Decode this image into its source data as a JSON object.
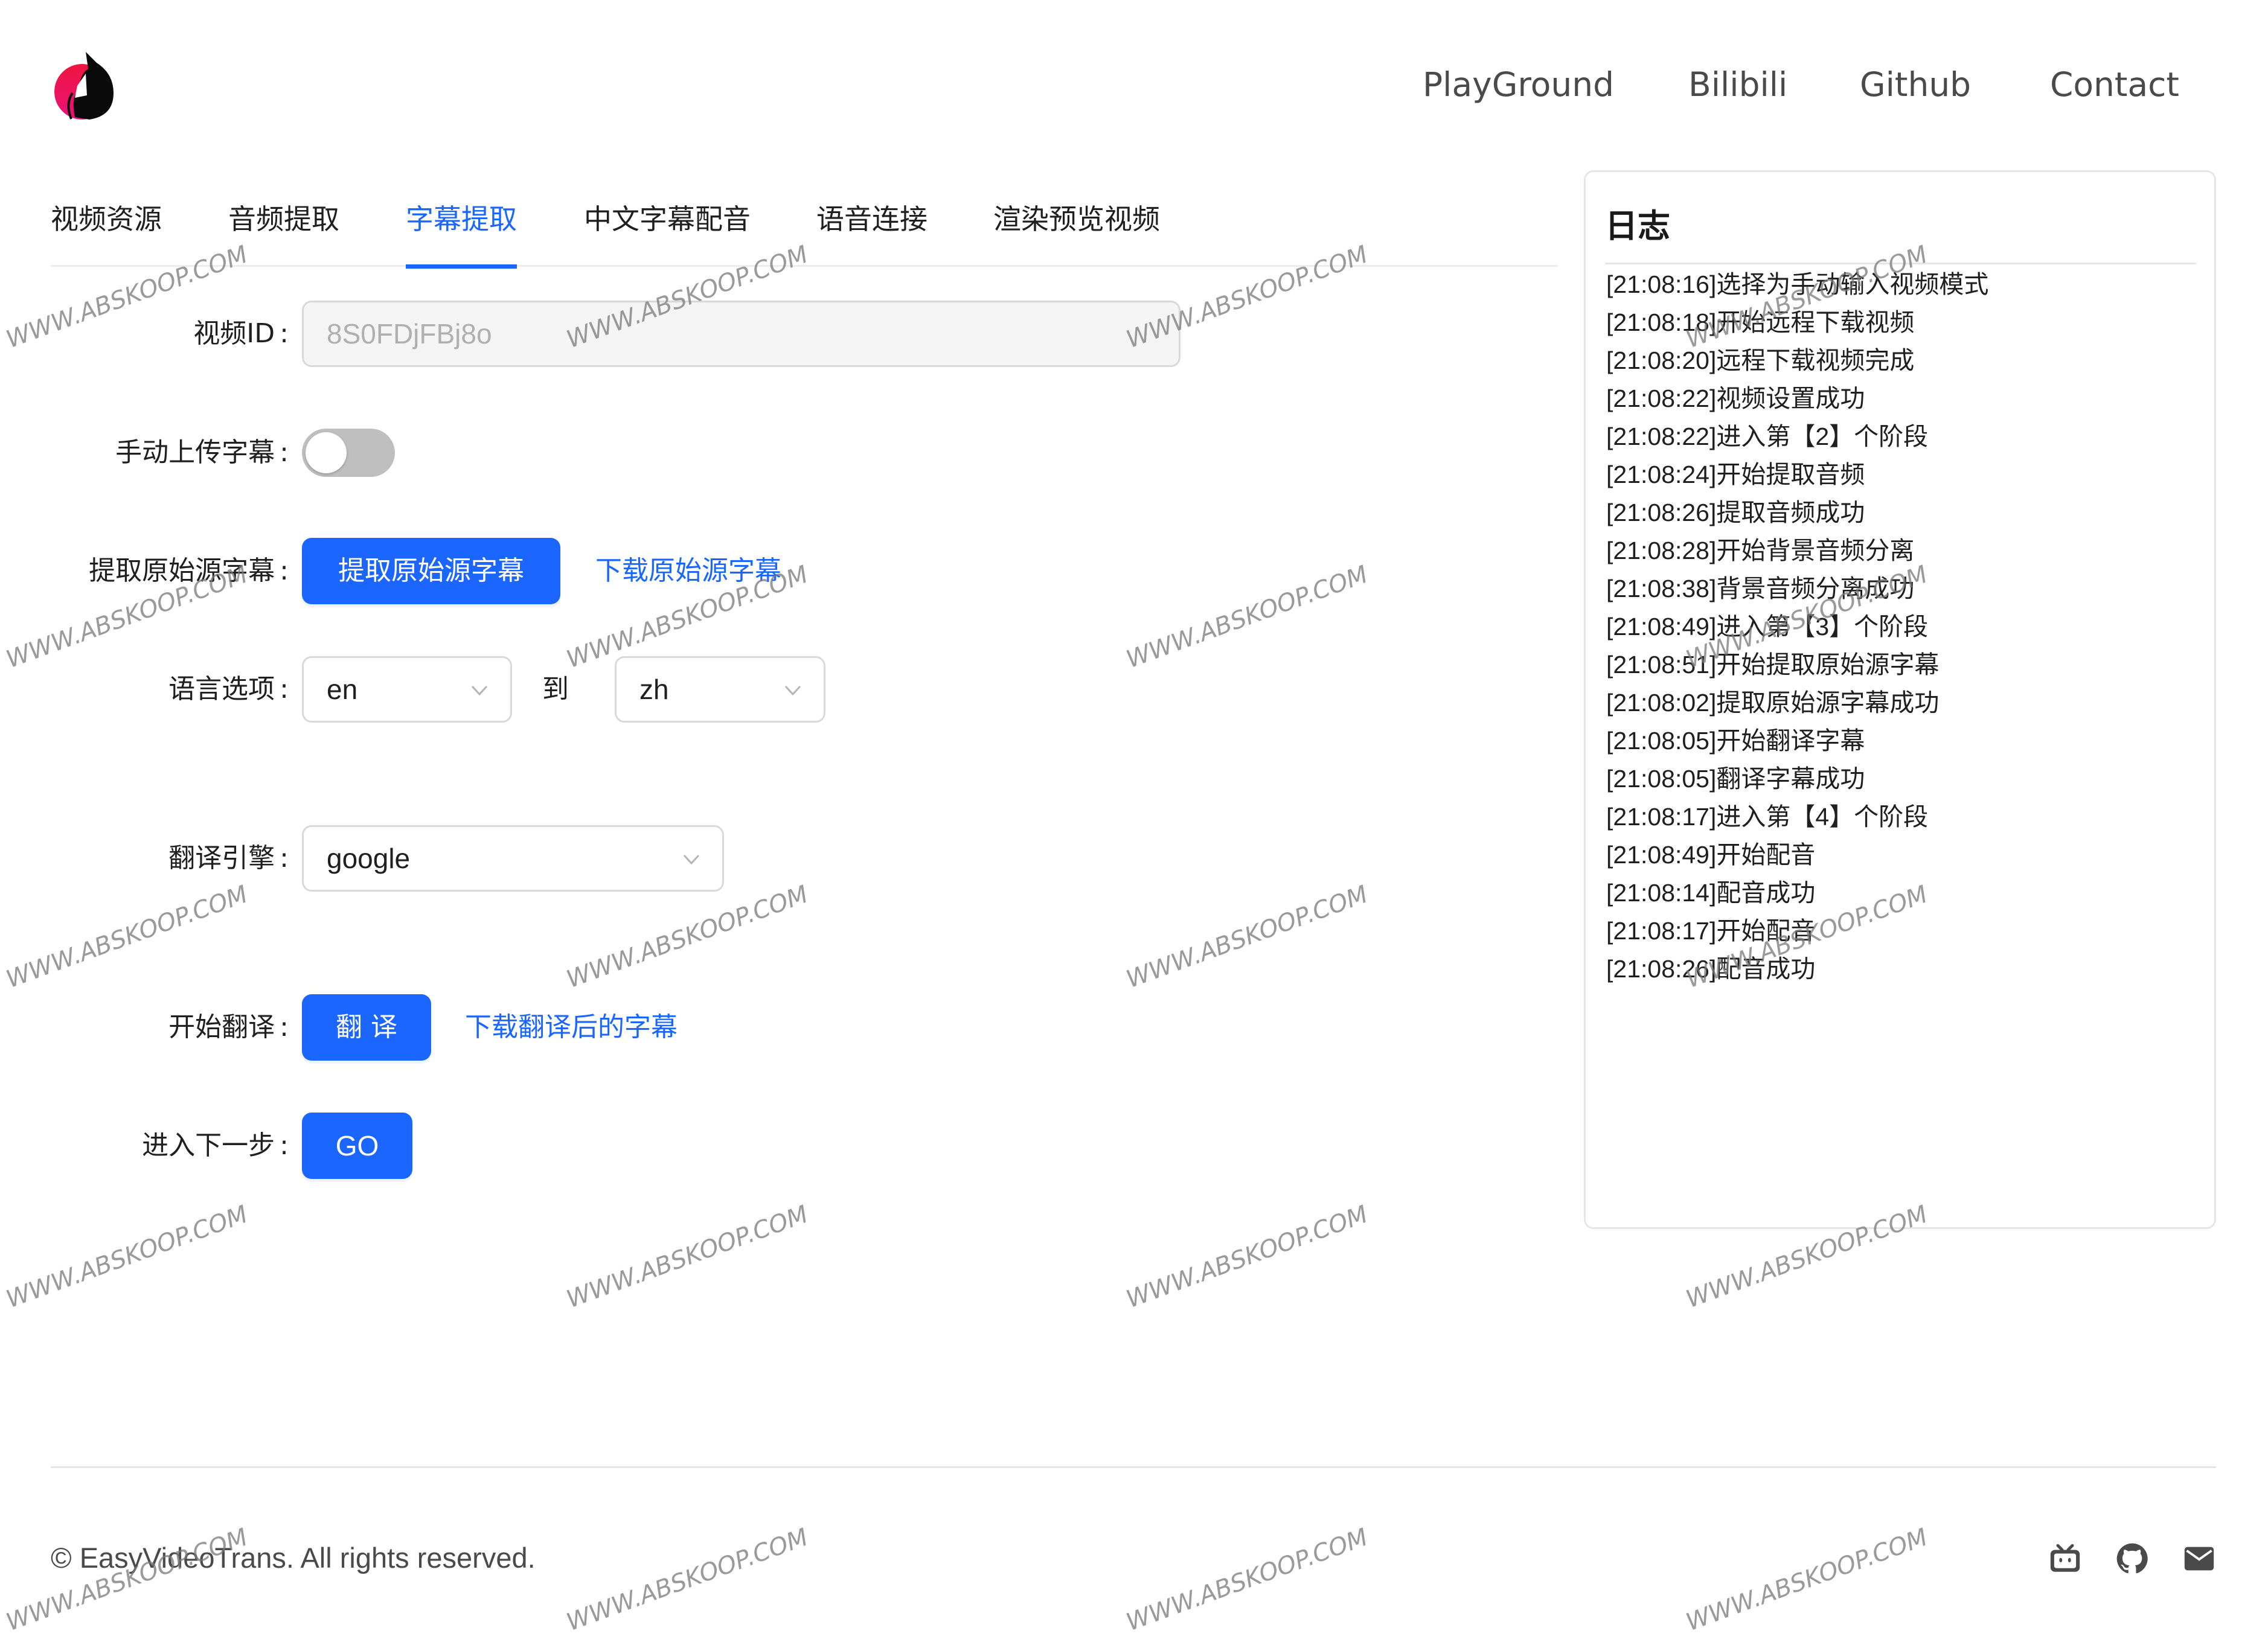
{
  "header": {
    "logo_alt": "cat-logo",
    "nav": [
      {
        "label": "PlayGround"
      },
      {
        "label": "Bilibili"
      },
      {
        "label": "Github"
      },
      {
        "label": "Contact"
      }
    ]
  },
  "tabs": [
    {
      "label": "视频资源",
      "active": false
    },
    {
      "label": "音频提取",
      "active": false
    },
    {
      "label": "字幕提取",
      "active": true
    },
    {
      "label": "中文字幕配音",
      "active": false
    },
    {
      "label": "语音连接",
      "active": false
    },
    {
      "label": "渲染预览视频",
      "active": false
    }
  ],
  "form": {
    "colon": ":",
    "video_id": {
      "label": "视频ID",
      "value": "8S0FDjFBj8o",
      "disabled": true
    },
    "manual_upload": {
      "label": "手动上传字幕",
      "checked": false
    },
    "extract": {
      "label": "提取原始源字幕",
      "button": "提取原始源字幕",
      "download_link": "下载原始源字幕"
    },
    "language": {
      "label": "语言选项",
      "source": "en",
      "to_label": "到",
      "target": "zh"
    },
    "engine": {
      "label": "翻译引擎",
      "value": "google"
    },
    "translate": {
      "label": "开始翻译",
      "button": "翻 译",
      "download_link": "下载翻译后的字幕"
    },
    "next_step": {
      "label": "进入下一步",
      "button": "GO"
    }
  },
  "log": {
    "title": "日志",
    "entries": [
      "[21:08:16]选择为手动输入视频模式",
      "[21:08:18]开始远程下载视频",
      "[21:08:20]远程下载视频完成",
      "[21:08:22]视频设置成功",
      "[21:08:22]进入第【2】个阶段",
      "[21:08:24]开始提取音频",
      "[21:08:26]提取音频成功",
      "[21:08:28]开始背景音频分离",
      "[21:08:38]背景音频分离成功",
      "[21:08:49]进入第【3】个阶段",
      "[21:08:51]开始提取原始源字幕",
      "[21:08:02]提取原始源字幕成功",
      "[21:08:05]开始翻译字幕",
      "[21:08:05]翻译字幕成功",
      "[21:08:17]进入第【4】个阶段",
      "[21:08:49]开始配音",
      "[21:08:14]配音成功",
      "[21:08:17]开始配音",
      "[21:08:26]配音成功"
    ]
  },
  "footer": {
    "copyright": "© EasyVideoTrans. All rights reserved.",
    "icons": [
      "bilibili-icon",
      "github-icon",
      "mail-icon"
    ]
  },
  "colors": {
    "primary": "#1a66ff",
    "text": "#1f1f1f",
    "muted": "#4a4a4a",
    "border": "#d9d9d9",
    "logo_red": "#e8174f"
  },
  "watermark": "WWW.ABSKOOP.COM"
}
